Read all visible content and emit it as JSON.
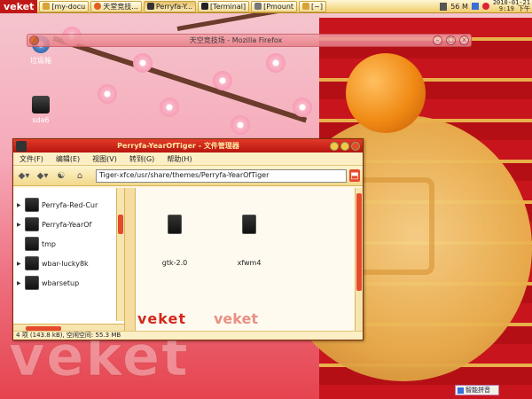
{
  "panel": {
    "brand": "veket",
    "tasks": [
      {
        "label": "[my-docu",
        "icon": "folder-icon"
      },
      {
        "label": "天堂竞技...",
        "icon": "firefox-icon"
      },
      {
        "label": "Perryfa-Y...",
        "icon": "filemanager-icon",
        "active": true
      },
      {
        "label": "[Terminal]",
        "icon": "terminal-icon"
      },
      {
        "label": "[Pmount",
        "icon": "drive-icon"
      },
      {
        "label": "[~]",
        "icon": "folder-icon"
      }
    ],
    "memory": "56 M",
    "date": "2010-01-21",
    "time": "9:19 下午"
  },
  "desktop": {
    "icons": [
      {
        "label": "垃圾箱",
        "icon": "trash-icon"
      },
      {
        "label": "sda6",
        "icon": "drive-icon"
      }
    ],
    "watermark": "veket"
  },
  "firefox_bar": {
    "title": "天空竞技场 - Mozilla Firefox"
  },
  "file_manager": {
    "title": "Perryfa-YearOfTiger - 文件管理器",
    "menu": [
      "文件(F)",
      "编辑(E)",
      "视图(V)",
      "转到(G)",
      "帮助(H)"
    ],
    "location": "Tiger-xfce/usr/share/themes/Perryfa-YearOfTiger",
    "sidebar": [
      {
        "label": "Perryfa-Red-Cur",
        "expandable": true
      },
      {
        "label": "Perryfa-YearOf",
        "expandable": true
      },
      {
        "label": "tmp",
        "expandable": false
      },
      {
        "label": "wbar-lucky8k",
        "expandable": true
      },
      {
        "label": "wbarsetup",
        "expandable": true
      }
    ],
    "files": [
      {
        "label": "gtk-2.0"
      },
      {
        "label": "xfwm4"
      }
    ],
    "watermark_left": "veket",
    "watermark_right": "veket",
    "status": "4 项 (143.8 kB), 空闲空间: 55.3 MB"
  },
  "ime": {
    "label": "智能拼音"
  },
  "colors": {
    "accent": "#c01818",
    "panel": "#f1cc6a",
    "scroll": "#e64a2c"
  }
}
